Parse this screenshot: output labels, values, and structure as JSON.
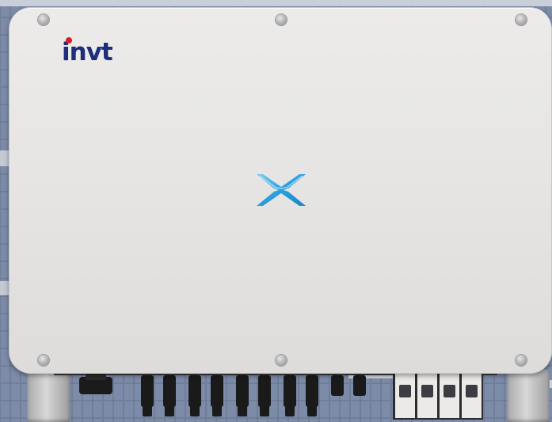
{
  "logo": {
    "text": "invt",
    "brand_color": "#1f2e7a",
    "dot_color": "#d61e26"
  },
  "indicator": {
    "icon": "x-status-indicator",
    "color": "#2a9fdc"
  },
  "screws": {
    "count": 6
  },
  "connectors": {
    "dc_connector_count": 10,
    "ac_terminal_count": 4
  },
  "background": {
    "subject": "solar panels"
  }
}
